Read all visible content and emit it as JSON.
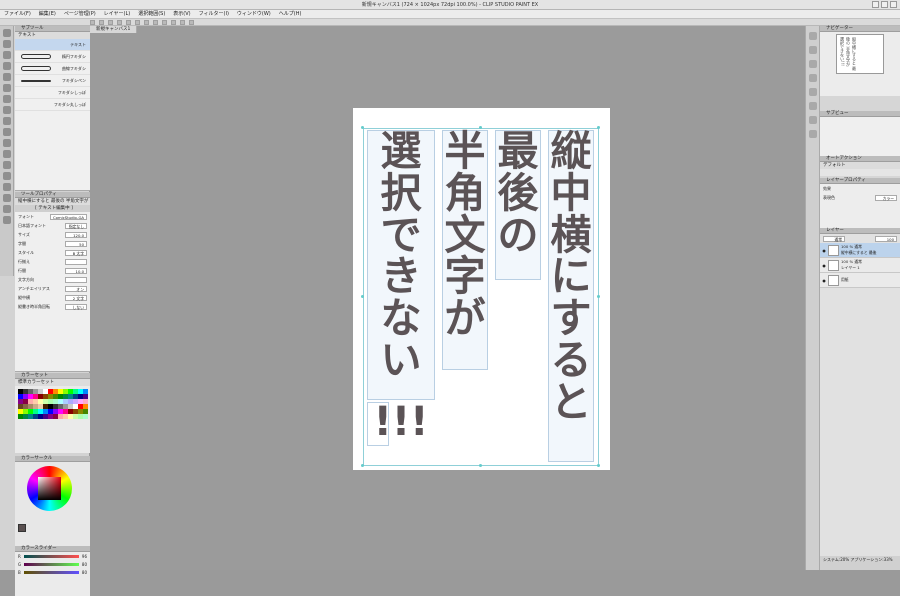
{
  "window": {
    "title": "新規キャンバス1 (724 × 1024px 72dpi 100.0%) - CLIP STUDIO PAINT EX"
  },
  "menu": [
    "ファイル(F)",
    "編集(E)",
    "ページ管理(P)",
    "レイヤー(L)",
    "選択範囲(S)",
    "表示(V)",
    "フィルター(I)",
    "ウィンドウ(W)",
    "ヘルプ(H)"
  ],
  "document_tab": "新規キャンバス1",
  "subtool": {
    "title": "サブツール",
    "group": "テキスト",
    "items": [
      "テキスト",
      "楕円フキダシ",
      "曲線フキダシ",
      "フキダシペン",
      "フキダシしっぽ",
      "フキダシ丸しっぽ"
    ]
  },
  "tool_property": {
    "title": "ツールプロパティ",
    "subtitle": "縦中横にすると 最後の 半角文字が",
    "section": "[ テキスト編集中 ]",
    "rows": [
      {
        "label": "フォント",
        "value": "ComicStudio-GA"
      },
      {
        "label": "日本語フォント",
        "value": "指定なし"
      },
      {
        "label": "サイズ",
        "value": "120.0"
      },
      {
        "label": "字間",
        "value": "50"
      },
      {
        "label": "スタイル",
        "value": "B 太字"
      },
      {
        "label": "行揃え",
        "value": ""
      },
      {
        "label": "行間",
        "value": "10.0"
      },
      {
        "label": "文字方向",
        "value": ""
      },
      {
        "label": "アンチエイリアス",
        "value": "オン"
      },
      {
        "label": "縦中横",
        "value": "2 文字"
      },
      {
        "label": "縦書き時半角回転",
        "value": "しない"
      }
    ]
  },
  "color_set": {
    "title": "カラーセット",
    "selected": "標準カラーセット"
  },
  "color_wheel": {
    "title": "カラーサークル"
  },
  "color_slider": {
    "title": "カラースライダー",
    "channels": [
      {
        "label": "R",
        "value": "96"
      },
      {
        "label": "G",
        "value": "80"
      },
      {
        "label": "B",
        "value": "80"
      }
    ]
  },
  "canvas_text": {
    "columns": [
      "縦中横にすると",
      "最後の",
      "半角文字が",
      "選択できない"
    ],
    "tail": "!!!"
  },
  "navigator": {
    "title": "ナビゲーター",
    "thumb_text": "縦中横にすると 最後の 半角文字が 選択できない!!!"
  },
  "sub_view": {
    "title": "サブビュー"
  },
  "auto_action": {
    "title": "オートアクション",
    "value": "デフォルト"
  },
  "layer_property": {
    "title": "レイヤープロパティ",
    "effect": "効果",
    "color_label": "表現色",
    "color_value": "カラー"
  },
  "layers": {
    "title": "レイヤー",
    "blend": "通常",
    "opacity": "100",
    "items": [
      {
        "name": "縦中横にすると 最後",
        "info": "100 % 通常"
      },
      {
        "name": "レイヤー 1",
        "info": "100 % 通常"
      },
      {
        "name": "用紙",
        "info": ""
      }
    ]
  },
  "status": "システム:20% アプリケーション:33%",
  "colors": {
    "accent": "#8fd0d8",
    "text": "#5b5356",
    "selection": "#bcd3ec"
  }
}
